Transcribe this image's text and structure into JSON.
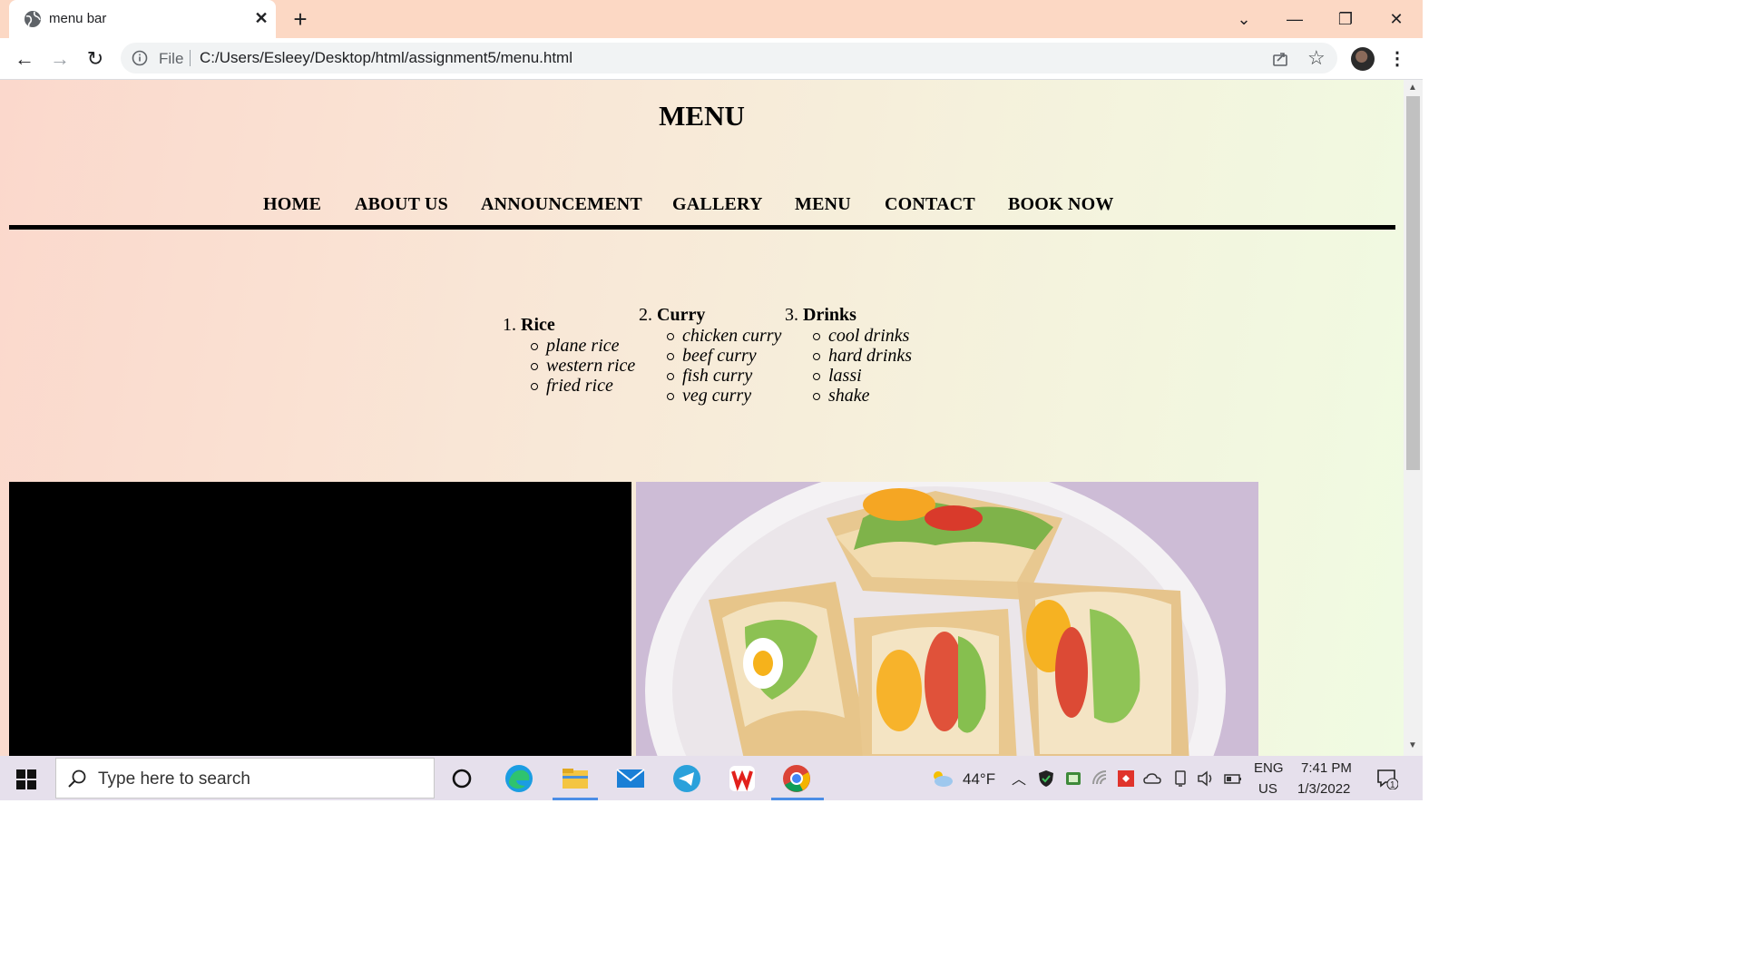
{
  "browser": {
    "tab_title": "menu bar",
    "address_scheme": "File",
    "address_url": "C:/Users/Esleey/Desktop/html/assignment5/menu.html"
  },
  "page": {
    "title": "MENU",
    "nav": [
      "HOME",
      "ABOUT US",
      "ANNOUNCEMENT",
      "GALLERY",
      "MENU",
      "CONTACT",
      "BOOK NOW"
    ],
    "menu": [
      {
        "num": "1.",
        "name": "Rice",
        "items": [
          "plane rice",
          "western rice",
          "fried rice"
        ]
      },
      {
        "num": "2.",
        "name": "Curry",
        "items": [
          "chicken curry",
          "beef curry",
          "fish curry",
          "veg curry"
        ]
      },
      {
        "num": "3.",
        "name": "Drinks",
        "items": [
          "cool drinks",
          "hard drinks",
          "lassi",
          "shake"
        ]
      }
    ]
  },
  "taskbar": {
    "search_placeholder": "Type here to search",
    "weather": "44°F",
    "lang1": "ENG",
    "lang2": "US",
    "time": "7:41 PM",
    "date": "1/3/2022",
    "notification_count": "1"
  },
  "colors": {
    "tabstrip": "#fcd8c4",
    "nav_rule": "#000000",
    "taskbar": "#e6e0ec"
  }
}
